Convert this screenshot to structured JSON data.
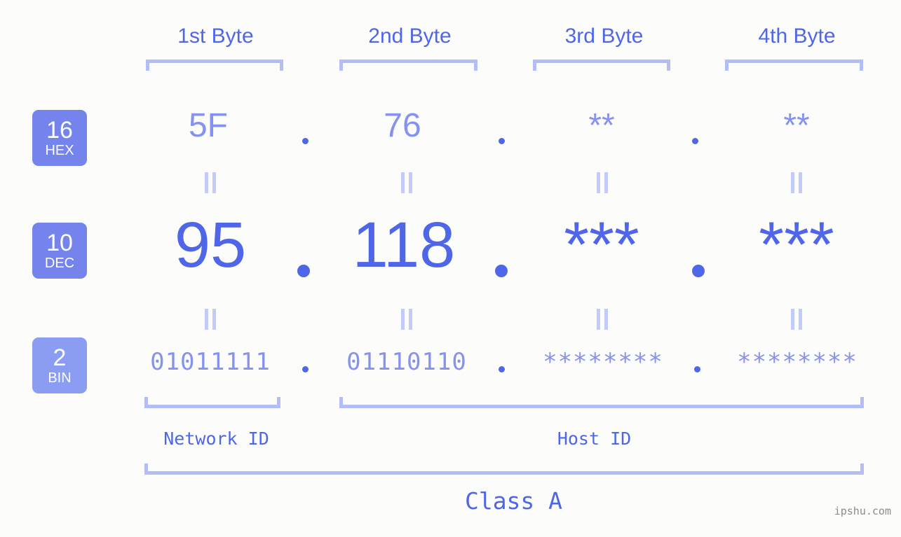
{
  "background_color": "#fcfdfa",
  "accent_color": "#4f66e8",
  "accent_light_color": "#8592f0",
  "bracket_color": "#b3bdf7",
  "badge_color": "#7484ec",
  "byte_headers": [
    {
      "label": "1st Byte"
    },
    {
      "label": "2nd Byte"
    },
    {
      "label": "3rd Byte"
    },
    {
      "label": "4th Byte"
    }
  ],
  "rows": [
    {
      "base_number": "16",
      "base_name": "HEX",
      "values": [
        "5F",
        "76",
        "**",
        "**"
      ],
      "separators": [
        ".",
        ".",
        "."
      ]
    },
    {
      "base_number": "10",
      "base_name": "DEC",
      "values": [
        "95",
        "118",
        "***",
        "***"
      ],
      "separators": [
        ".",
        ".",
        "."
      ]
    },
    {
      "base_number": "2",
      "base_name": "BIN",
      "values": [
        "01011111",
        "01110110",
        "********",
        "********"
      ],
      "separators": [
        ".",
        ".",
        "."
      ]
    }
  ],
  "equals_symbol": "=",
  "segments": {
    "network_id": "Network ID",
    "host_id": "Host ID",
    "class": "Class A"
  },
  "watermark": "ipshu.com"
}
